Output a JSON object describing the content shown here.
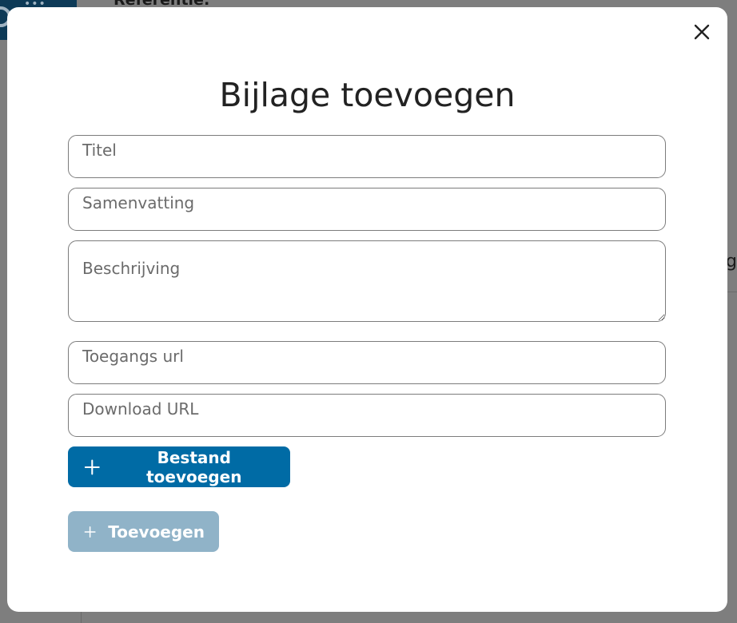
{
  "background": {
    "reference_label": "Referentie:",
    "partial_text": "g"
  },
  "modal": {
    "title": "Bijlage toevoegen",
    "close_icon": "close-icon",
    "fields": {
      "titel": {
        "placeholder": "Titel",
        "value": ""
      },
      "samenvatting": {
        "placeholder": "Samenvatting",
        "value": ""
      },
      "beschrijving": {
        "placeholder": "Beschrijving",
        "value": ""
      },
      "toegangs_url": {
        "placeholder": "Toegangs url",
        "value": ""
      },
      "download_url": {
        "placeholder": "Download URL",
        "value": ""
      }
    },
    "buttons": {
      "add_file_label": "Bestand toevoegen",
      "add_label": "Toevoegen",
      "add_disabled": true
    }
  },
  "colors": {
    "primary": "#006ba5",
    "primary_disabled": "#90b3c8",
    "overlay": "#7e7e7e",
    "modal_bg": "#ffffff",
    "field_border": "#7c7c7c",
    "title_text": "#222222"
  }
}
